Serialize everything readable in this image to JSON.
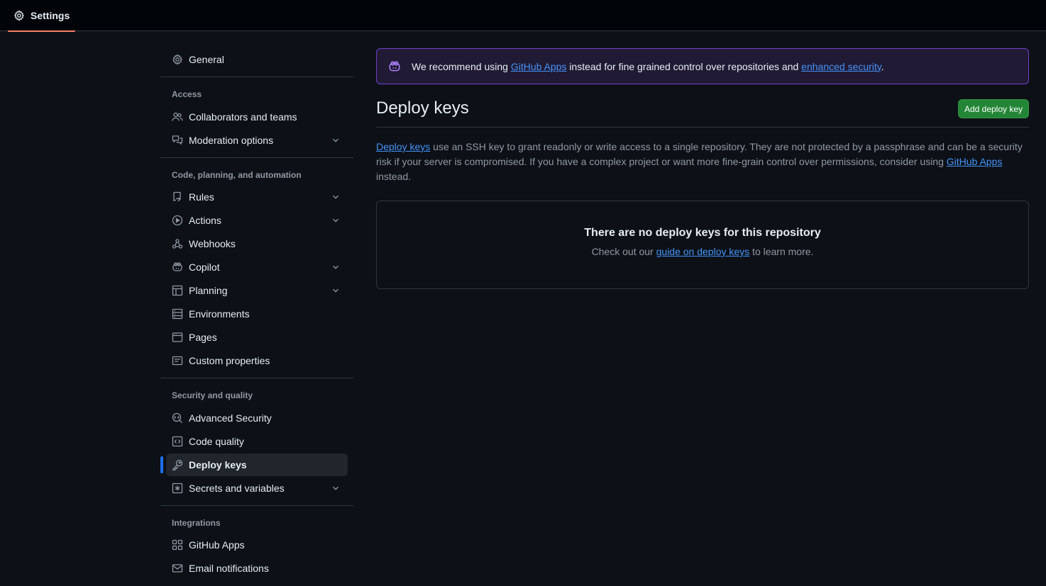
{
  "header": {
    "tab_label": "Settings"
  },
  "sidebar": {
    "general": "General",
    "sections": {
      "access": "Access",
      "code": "Code, planning, and automation",
      "security": "Security and quality",
      "integrations": "Integrations"
    },
    "items": {
      "collaborators": "Collaborators and teams",
      "moderation": "Moderation options",
      "rules": "Rules",
      "actions": "Actions",
      "webhooks": "Webhooks",
      "copilot": "Copilot",
      "planning": "Planning",
      "environments": "Environments",
      "pages": "Pages",
      "custom_properties": "Custom properties",
      "advanced_security": "Advanced Security",
      "code_quality": "Code quality",
      "deploy_keys": "Deploy keys",
      "secrets": "Secrets and variables",
      "github_apps": "GitHub Apps",
      "email_notifications": "Email notifications"
    }
  },
  "banner": {
    "prefix": "We recommend using ",
    "link1": "GitHub Apps",
    "middle": " instead for fine grained control over repositories and ",
    "link2": "enhanced security",
    "suffix": "."
  },
  "main": {
    "title": "Deploy keys",
    "add_button": "Add deploy key",
    "desc_link1": "Deploy keys",
    "desc_text": " use an SSH key to grant readonly or write access to a single repository. They are not protected by a passphrase and can be a security risk if your server is compromised. If you have a complex project or want more fine-grain control over permissions, consider using ",
    "desc_link2": "GitHub Apps",
    "desc_suffix": " instead.",
    "empty_title": "There are no deploy keys for this repository",
    "empty_prefix": "Check out our ",
    "empty_link": "guide on deploy keys",
    "empty_suffix": " to learn more."
  },
  "colors": {
    "accent_active": "#1f6feb",
    "button_green": "#238636",
    "banner_border": "#6e40c9",
    "tab_underline": "#f78166"
  }
}
